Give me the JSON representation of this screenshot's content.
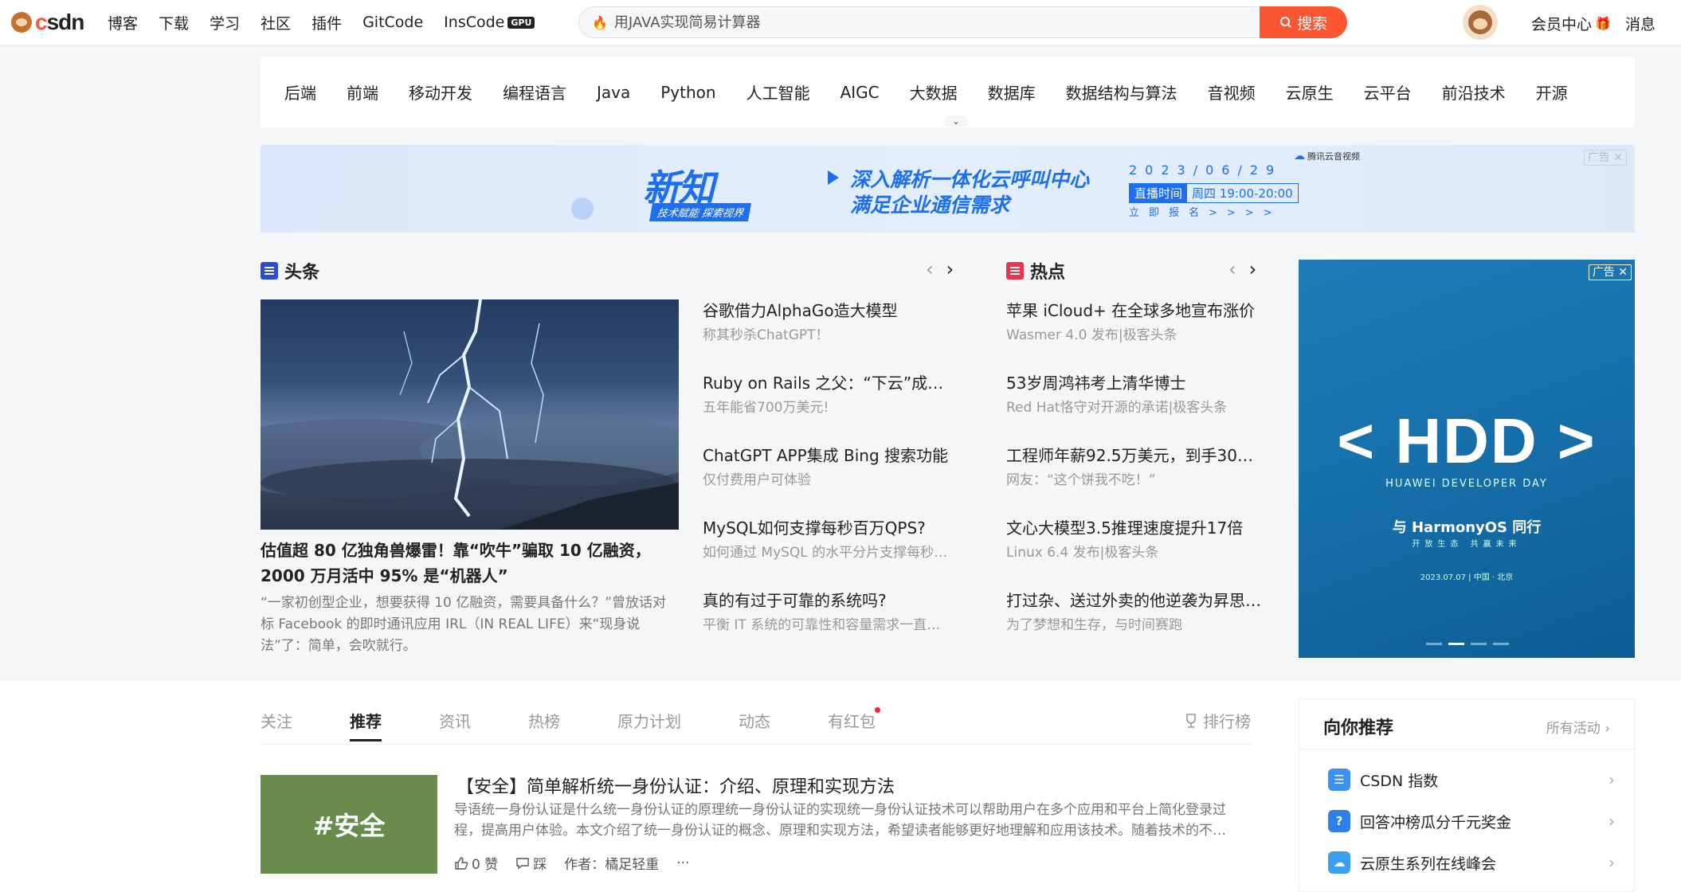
{
  "toolbar": {
    "brand": "csdn",
    "nav": [
      "博客",
      "下载",
      "学习",
      "社区",
      "插件",
      "GitCode",
      "InsCode"
    ],
    "gpu_badge": "GPU",
    "search_placeholder": "用JAVA实现简易计算器",
    "search_button": "搜索",
    "vip": "会员中心",
    "messages": "消息"
  },
  "categories": [
    "后端",
    "前端",
    "移动开发",
    "编程语言",
    "Java",
    "Python",
    "人工智能",
    "AIGC",
    "大数据",
    "数据库",
    "数据结构与算法",
    "音视频",
    "云原生",
    "云平台",
    "前沿技术",
    "开源"
  ],
  "banner": {
    "logo_text": "新知",
    "logo_sub": "技术赋能 探索视界",
    "headline_1": "深入解析一体化云呼叫中心",
    "headline_2": "满足企业通信需求",
    "date": "2023/06/29",
    "time_label": "直播时间",
    "time_value": "周四 19:00-20:00",
    "register": "立即报名>>>>",
    "sponsor": "腾讯云音视频",
    "ad_tag": "广告"
  },
  "headlines": {
    "title": "头条",
    "hero": {
      "title": "估值超 80 亿独角兽爆雷！靠“吹牛”骗取 10 亿融资，2000 万月活中 95% 是“机器人”",
      "desc": "“一家初创型企业，想要获得 10 亿融资，需要具备什么？”曾放话对标 Facebook 的即时通讯应用 IRL（IN REAL LIFE）来“现身说法”了：简单，会吹就行。"
    },
    "items": [
      {
        "title": "谷歌借力AlphaGo造大模型",
        "sub": "称其秒杀ChatGPT！"
      },
      {
        "title": "Ruby on Rails 之父：“下云”成功…",
        "sub": "五年能省700万美元!"
      },
      {
        "title": "ChatGPT APP集成 Bing 搜索功能",
        "sub": "仅付费用户可体验"
      },
      {
        "title": "MySQL如何支撑每秒百万QPS?",
        "sub": "如何通过 MySQL 的水平分片支撑每秒…"
      },
      {
        "title": "真的有过于可靠的系统吗?",
        "sub": "平衡 IT 系统的可靠性和容量需求一直…"
      }
    ]
  },
  "hot": {
    "title": "热点",
    "items": [
      {
        "title": "苹果 iCloud+ 在全球多地宣布涨价",
        "sub": "Wasmer 4.0 发布|极客头条"
      },
      {
        "title": "53岁周鸿祎考上清华博士",
        "sub": "Red Hat恪守对开源的承诺|极客头条"
      },
      {
        "title": "工程师年薪92.5万美元，到手30…",
        "sub": "网友：“这个饼我不吃！”"
      },
      {
        "title": "文心大模型3.5推理速度提升17倍",
        "sub": "Linux 6.4 发布|极客头条"
      },
      {
        "title": "打过杂、送过外卖的他逆袭为昇思…",
        "sub": "为了梦想和生存，与时间赛跑"
      }
    ]
  },
  "side_ad": {
    "ad_tag": "广告",
    "hdd": "< HDD >",
    "hdd_sub": "HUAWEI DEVELOPER DAY",
    "harmony": "与 HarmonyOS 同行",
    "harmony_sub": "开放生态 共赢未来",
    "date": "2023.07.07 | 中国 · 北京"
  },
  "feed": {
    "tabs": [
      "关注",
      "推荐",
      "资讯",
      "热榜",
      "原力计划",
      "动态",
      "有红包"
    ],
    "active_tab": "推荐",
    "rank": "排行榜",
    "article": {
      "thumb_text": "#安全",
      "title": "【安全】简单解析统一身份认证：介绍、原理和实现方法",
      "desc": "导语统一身份认证是什么统一身份认证的原理统一身份认证的实现统一身份认证技术可以帮助用户在多个应用和平台上简化登录过程，提高用户体验。本文介绍了统一身份认证的概念、原理和实现方法，希望读者能够更好地理解和应用该技术。随着技术的不…",
      "likes": "0 赞",
      "dislike": "踩",
      "author": "作者：橘足轻重",
      "more": "···"
    }
  },
  "recommend": {
    "title": "向你推荐",
    "all": "所有活动",
    "items": [
      {
        "label": "CSDN 指数",
        "color": "#3d8ff0"
      },
      {
        "label": "回答冲榜瓜分千元奖金",
        "color": "#2f7fe8"
      },
      {
        "label": "云原生系列在线峰会",
        "color": "#3aa0ee"
      }
    ]
  }
}
